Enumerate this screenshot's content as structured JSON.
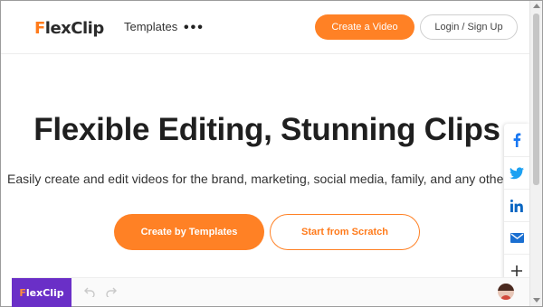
{
  "header": {
    "logo": {
      "first_letter": "F",
      "rest": "lexClip"
    },
    "nav_templates": "Templates",
    "nav_more": "•••",
    "create_video_label": "Create a Video",
    "login_label": "Login / Sign Up"
  },
  "hero": {
    "title": "Flexible Editing, Stunning Clips",
    "subtitle": "Easily create and edit videos for the brand, marketing, social media, family, and any other purpo",
    "primary_cta": "Create by Templates",
    "secondary_cta": "Start from Scratch"
  },
  "share": {
    "items": [
      "facebook-icon",
      "twitter-icon",
      "linkedin-icon",
      "email-icon",
      "plus-icon"
    ],
    "colors": {
      "facebook": "#1877f2",
      "twitter": "#1da1f2",
      "linkedin": "#0a66c2",
      "email": "#1a6fd1",
      "plus": "#333333"
    }
  },
  "preview": {
    "logo": {
      "first_letter": "F",
      "rest": "lexClip"
    }
  },
  "colors": {
    "accent": "#ff8125",
    "preview_brand": "#6a2fc7"
  }
}
